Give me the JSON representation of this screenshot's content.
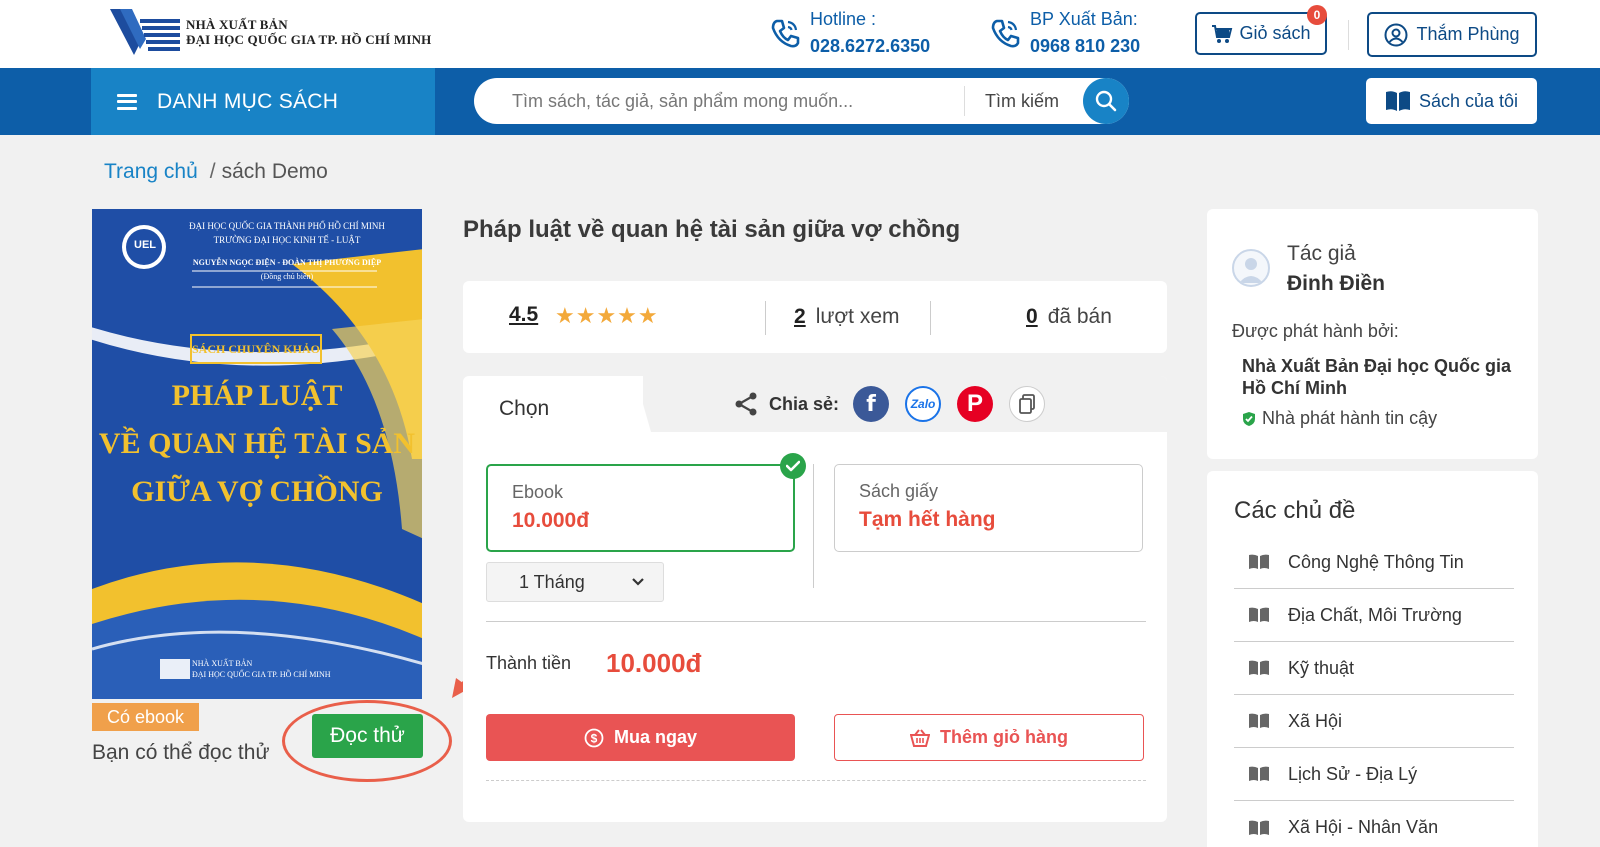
{
  "header": {
    "logo": {
      "line1": "NHÀ XUẤT BẢN",
      "line2": "ĐẠI HỌC QUỐC GIA TP. HỒ CHÍ MINH"
    },
    "hotline": {
      "label": "Hotline :",
      "number": "028.6272.6350"
    },
    "bp": {
      "label": "BP Xuất Bản:",
      "number": "0968 810 230"
    },
    "cart": {
      "label": "Giỏ sách",
      "count": "0"
    },
    "user": {
      "name": "Thắm Phùng"
    }
  },
  "nav": {
    "catalog_label": "DANH MỤC SÁCH",
    "search_placeholder": "Tìm sách, tác giả, sản phẩm mong muốn...",
    "search_label": "Tìm kiếm",
    "my_books_label": "Sách của tôi"
  },
  "breadcrumb": {
    "home": "Trang chủ",
    "separator": "/",
    "current": "sách Demo"
  },
  "cover": {
    "university": "ĐẠI HỌC QUỐC GIA THÀNH PHỐ HỒ CHÍ MINH",
    "school": "TRƯỜNG ĐẠI HỌC KINH TẾ - LUẬT",
    "authors": "NGUYỄN NGỌC ĐIỆN - ĐOÀN THỊ PHƯƠNG DIỆP",
    "editor_note": "(Đồng chủ biên)",
    "series": "SÁCH CHUYÊN KHẢO",
    "title_line1": "PHÁP LUẬT",
    "title_line2": "VỀ QUAN HỆ TÀI SẢN",
    "title_line3": "GIỮA VỢ CHỒNG",
    "emblem": "UEL",
    "publisher_line1": "NHÀ XUẤT BẢN",
    "publisher_line2": "ĐẠI HỌC QUỐC GIA TP. HỒ CHÍ MINH"
  },
  "book": {
    "ebook_badge": "Có ebook",
    "read_hint": "Bạn có thể đọc thử",
    "read_button": "Đọc thử",
    "title": "Pháp luật về quan hệ tài sản giữa vợ chồng",
    "rating": "4.5",
    "stars": "★★★★★",
    "views": "2",
    "views_label": "lượt xem",
    "sold": "0",
    "sold_label": "đã bán"
  },
  "purchase": {
    "tab_label": "Chọn",
    "share_label": "Chia sẻ:",
    "zalo_text": "Zalo",
    "fb_text": "f",
    "pin_text": "P",
    "options": [
      {
        "name": "Ebook",
        "price": "10.000đ",
        "selected": true
      },
      {
        "name": "Sách giấy",
        "price": "Tạm hết hàng",
        "selected": false
      }
    ],
    "duration": "1 Tháng",
    "total_label": "Thành tiền",
    "total_value": "10.000đ",
    "buy_label": "Mua ngay",
    "add_cart_label": "Thêm giỏ hàng"
  },
  "author": {
    "label": "Tác giả",
    "name": "Đinh Điền",
    "publisher_label": "Được phát hành bởi:",
    "publisher": "Nhà Xuất Bản Đại học Quốc gia Hồ Chí Minh",
    "trusted": "Nhà phát hành tin cậy"
  },
  "topics": {
    "title": "Các chủ đề",
    "items": [
      "Công Nghệ Thông Tin",
      "Địa Chất, Môi Trường",
      "Kỹ thuật",
      "Xã Hội",
      "Lịch Sử - Địa Lý",
      "Xã Hội - Nhân Văn"
    ]
  },
  "colors": {
    "primary": "#0d5ea8",
    "accent": "#1883c6",
    "price": "#e74c3c",
    "success": "#2aa44a",
    "badge": "#f0a04b"
  }
}
